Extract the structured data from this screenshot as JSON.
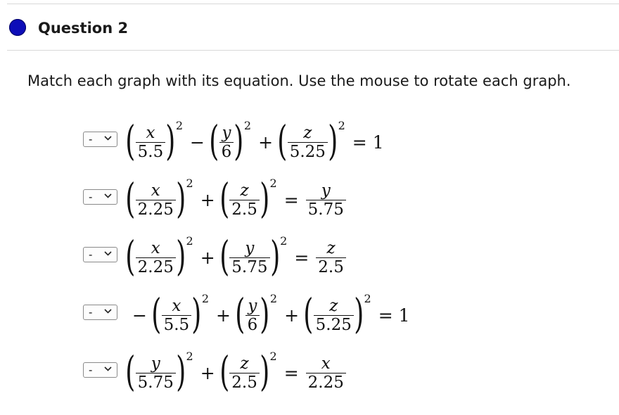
{
  "question": {
    "title": "Question 2",
    "prompt": "Match each graph with its equation. Use the mouse to rotate each graph.",
    "dot_color": "#0d0db8"
  },
  "select_default": "-",
  "equations": [
    {
      "terms": [
        {
          "sign": "",
          "num": "x",
          "den": "5.5",
          "exp": "2"
        },
        {
          "sign": "−",
          "num": "y",
          "den": "6",
          "exp": "2"
        },
        {
          "sign": "+",
          "num": "z",
          "den": "5.25",
          "exp": "2"
        }
      ],
      "equals": "=",
      "rhs": {
        "kind": "const",
        "value": "1"
      }
    },
    {
      "terms": [
        {
          "sign": "",
          "num": "x",
          "den": "2.25",
          "exp": "2"
        },
        {
          "sign": "+",
          "num": "z",
          "den": "2.5",
          "exp": "2"
        }
      ],
      "equals": "=",
      "rhs": {
        "kind": "frac",
        "num": "y",
        "den": "5.75"
      }
    },
    {
      "terms": [
        {
          "sign": "",
          "num": "x",
          "den": "2.25",
          "exp": "2"
        },
        {
          "sign": "+",
          "num": "y",
          "den": "5.75",
          "exp": "2"
        }
      ],
      "equals": "=",
      "rhs": {
        "kind": "frac",
        "num": "z",
        "den": "2.5"
      }
    },
    {
      "terms": [
        {
          "sign": "−",
          "num": "x",
          "den": "5.5",
          "exp": "2"
        },
        {
          "sign": "+",
          "num": "y",
          "den": "6",
          "exp": "2"
        },
        {
          "sign": "+",
          "num": "z",
          "den": "5.25",
          "exp": "2"
        }
      ],
      "equals": "=",
      "rhs": {
        "kind": "const",
        "value": "1"
      }
    },
    {
      "terms": [
        {
          "sign": "",
          "num": "y",
          "den": "5.75",
          "exp": "2"
        },
        {
          "sign": "+",
          "num": "z",
          "den": "2.5",
          "exp": "2"
        }
      ],
      "equals": "=",
      "rhs": {
        "kind": "frac",
        "num": "x",
        "den": "2.25"
      }
    }
  ]
}
